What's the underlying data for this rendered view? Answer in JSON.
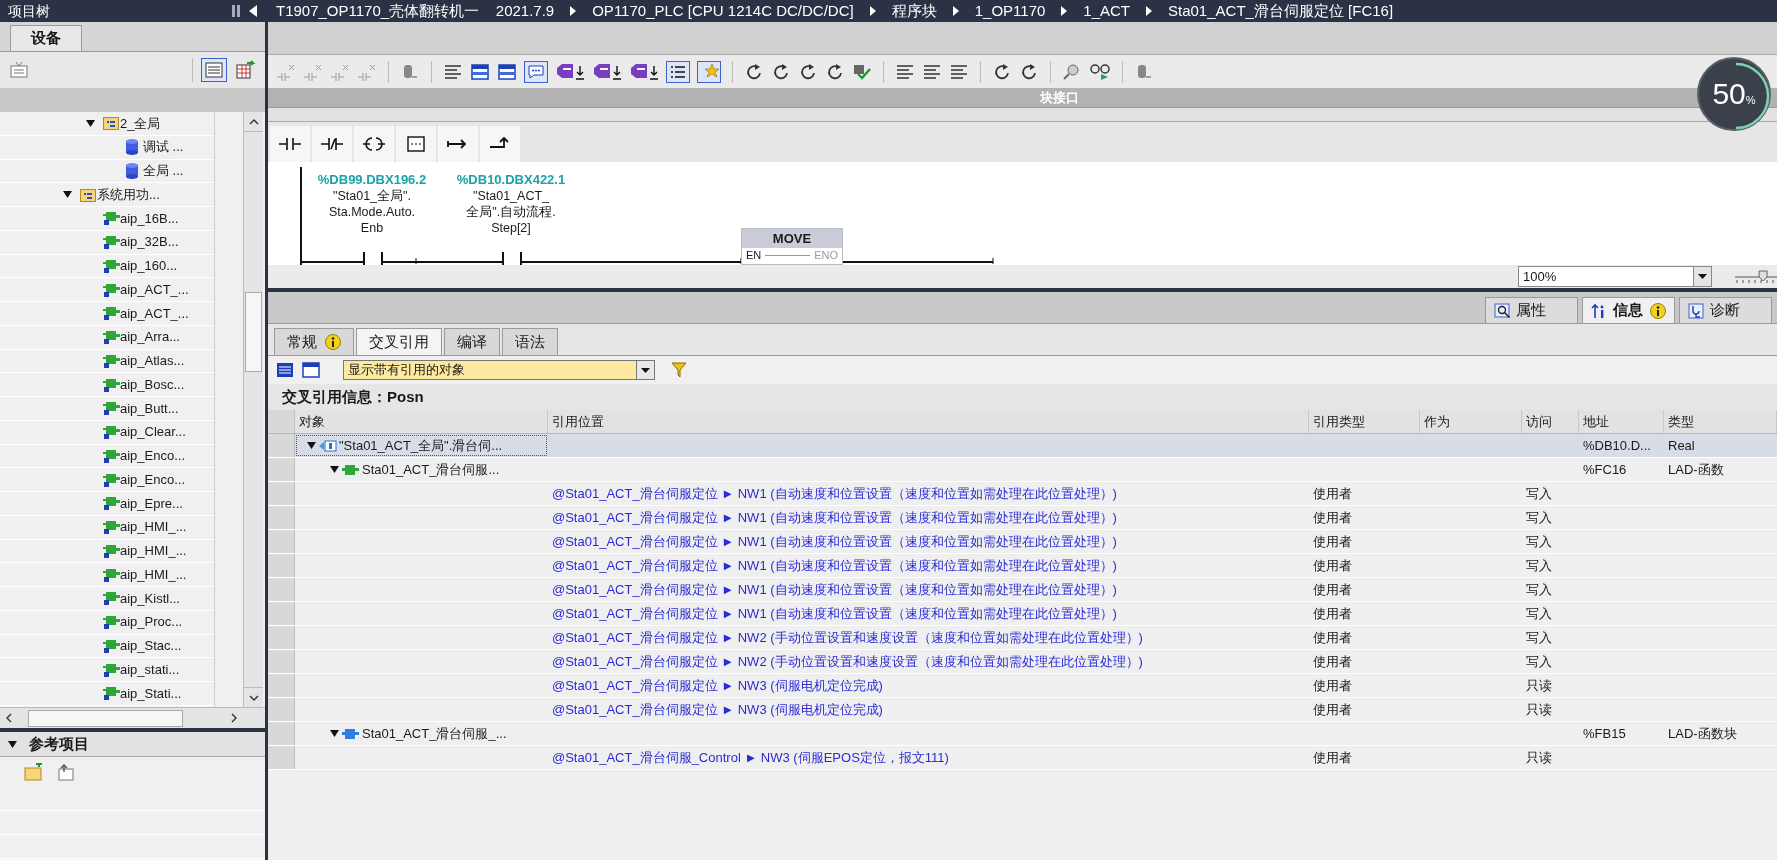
{
  "title_bar": {
    "panel_title": "项目树",
    "breadcrumb": [
      "T1907_OP1170_壳体翻转机一    2021.7.9",
      "OP1170_PLC [CPU 1214C DC/DC/DC]",
      "程序块",
      "1_OP1170",
      "1_ACT",
      "Sta01_ACT_滑台伺服定位 [FC16]"
    ]
  },
  "project_tree": {
    "tabs": [
      {
        "label": "设备",
        "selected": true
      }
    ],
    "items": [
      {
        "children": [
          {
            "label": "2_全局",
            "kind": "folder",
            "expanded": true,
            "children": [
              {
                "label": "调试 ...",
                "kind": "db"
              },
              {
                "label": "全局 ...",
                "kind": "db"
              }
            ]
          }
        ]
      },
      {
        "label": "系统用功...",
        "kind": "folder",
        "expanded": true,
        "children": [
          {
            "label": "aip_16B...",
            "kind": "block"
          },
          {
            "label": "aip_32B...",
            "kind": "block"
          },
          {
            "label": "aip_160...",
            "kind": "block"
          },
          {
            "label": "aip_ACT_...",
            "kind": "block"
          },
          {
            "label": "aip_ACT_...",
            "kind": "block"
          },
          {
            "label": "aip_Arra...",
            "kind": "block"
          },
          {
            "label": "aip_Atlas...",
            "kind": "block"
          },
          {
            "label": "aip_Bosc...",
            "kind": "block"
          },
          {
            "label": "aip_Butt...",
            "kind": "block"
          },
          {
            "label": "aip_Clear...",
            "kind": "block"
          },
          {
            "label": "aip_Enco...",
            "kind": "block"
          },
          {
            "label": "aip_Enco...",
            "kind": "block"
          },
          {
            "label": "aip_Epre...",
            "kind": "block"
          },
          {
            "label": "aip_HMI_...",
            "kind": "block"
          },
          {
            "label": "aip_HMI_...",
            "kind": "block"
          },
          {
            "label": "aip_HMI_...",
            "kind": "block"
          },
          {
            "label": "aip_Kistl...",
            "kind": "block"
          },
          {
            "label": "aip_Proc...",
            "kind": "block"
          },
          {
            "label": "aip_Stac...",
            "kind": "block"
          },
          {
            "label": "aip_stati...",
            "kind": "block"
          },
          {
            "label": "aip_Stati...",
            "kind": "block"
          }
        ]
      }
    ],
    "reference_panel": {
      "title": "参考项目",
      "expanded": true
    }
  },
  "editor": {
    "block_interface": "块接口",
    "ladder": {
      "contacts": [
        {
          "address": "%DB99.DBX196.2",
          "tag": [
            "\"Sta01_全局\".",
            "Sta.Mode.Auto.",
            "Enb"
          ]
        },
        {
          "address": "%DB10.DBX422.1",
          "tag": [
            "\"Sta01_ACT_",
            "全局\".自动流程.",
            "Step[2]"
          ]
        }
      ],
      "box": {
        "title": "MOVE",
        "pins": [
          "EN",
          "ENO"
        ]
      }
    },
    "zoom": {
      "value": "100%",
      "slider": {
        "level": 0.7
      }
    }
  },
  "monitor_widget": {
    "value": "50",
    "unit": "%",
    "level": 0.5
  },
  "inspector": {
    "tabs": [
      {
        "label": "属性",
        "kind": "properties",
        "selected": false
      },
      {
        "label": "信息",
        "kind": "info",
        "selected": true,
        "badge": true
      },
      {
        "label": "诊断",
        "kind": "diagnostics",
        "selected": false
      }
    ],
    "subtabs": [
      {
        "label": "常规",
        "selected": false,
        "badge": true
      },
      {
        "label": "交叉引用",
        "selected": true
      },
      {
        "label": "编译",
        "selected": false
      },
      {
        "label": "语法",
        "selected": false
      }
    ],
    "filter": "显示带有引用的对象",
    "heading": "交叉引用信息：Posn",
    "columns": [
      "对象",
      "引用位置",
      "引用类型",
      "作为",
      "访问",
      "地址",
      "类型"
    ],
    "objects": [
      {
        "name": "\"Sta01_ACT_全局\".滑台伺...",
        "kind": "tag",
        "expanded": true,
        "selected": true,
        "address": "%DB10.D...",
        "type": "Real",
        "children": [
          {
            "name": "Sta01_ACT_滑台伺服...",
            "kind": "fc",
            "expanded": true,
            "selected": false,
            "address": "%FC16",
            "type": "LAD-函数",
            "references": [
              {
                "location": "@Sta01_ACT_滑台伺服定位 ► NW1 (自动速度和位置设置（速度和位置如需处理在此位置处理）)",
                "ref_type": "使用者",
                "access": "写入"
              },
              {
                "location": "@Sta01_ACT_滑台伺服定位 ► NW1 (自动速度和位置设置（速度和位置如需处理在此位置处理）)",
                "ref_type": "使用者",
                "access": "写入"
              },
              {
                "location": "@Sta01_ACT_滑台伺服定位 ► NW1 (自动速度和位置设置（速度和位置如需处理在此位置处理）)",
                "ref_type": "使用者",
                "access": "写入"
              },
              {
                "location": "@Sta01_ACT_滑台伺服定位 ► NW1 (自动速度和位置设置（速度和位置如需处理在此位置处理）)",
                "ref_type": "使用者",
                "access": "写入"
              },
              {
                "location": "@Sta01_ACT_滑台伺服定位 ► NW1 (自动速度和位置设置（速度和位置如需处理在此位置处理）)",
                "ref_type": "使用者",
                "access": "写入"
              },
              {
                "location": "@Sta01_ACT_滑台伺服定位 ► NW1 (自动速度和位置设置（速度和位置如需处理在此位置处理）)",
                "ref_type": "使用者",
                "access": "写入"
              },
              {
                "location": "@Sta01_ACT_滑台伺服定位 ► NW2 (手动位置设置和速度设置（速度和位置如需处理在此位置处理）)",
                "ref_type": "使用者",
                "access": "写入"
              },
              {
                "location": "@Sta01_ACT_滑台伺服定位 ► NW2 (手动位置设置和速度设置（速度和位置如需处理在此位置处理）)",
                "ref_type": "使用者",
                "access": "写入"
              },
              {
                "location": "@Sta01_ACT_滑台伺服定位 ► NW3 (伺服电机定位完成)",
                "ref_type": "使用者",
                "access": "只读"
              },
              {
                "location": "@Sta01_ACT_滑台伺服定位 ► NW3 (伺服电机定位完成)",
                "ref_type": "使用者",
                "access": "只读"
              }
            ]
          },
          {
            "name": "Sta01_ACT_滑台伺服_...",
            "kind": "fb",
            "expanded": true,
            "selected": false,
            "address": "%FB15",
            "type": "LAD-函数块",
            "references": [
              {
                "location": "@Sta01_ACT_滑台伺服_Control ► NW3 (伺服EPOS定位，报文111)",
                "ref_type": "使用者",
                "access": "只读"
              }
            ]
          }
        ]
      }
    ]
  }
}
